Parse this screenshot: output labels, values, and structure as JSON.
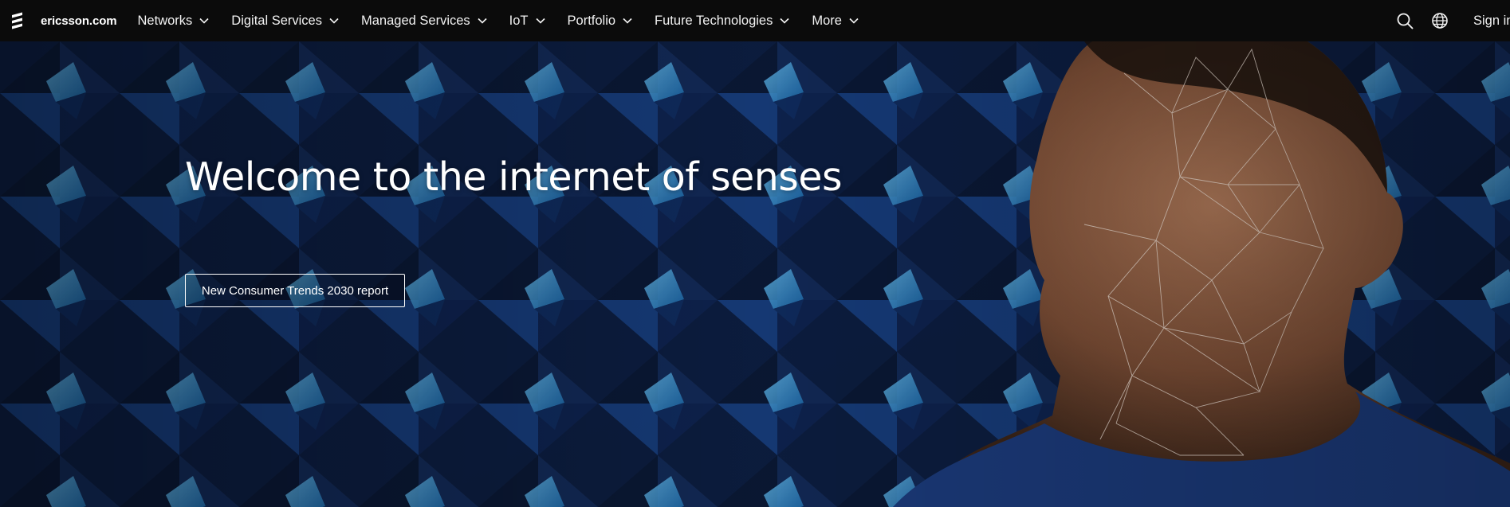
{
  "nav": {
    "brand": "ericsson.com",
    "items": [
      {
        "label": "Networks"
      },
      {
        "label": "Digital Services"
      },
      {
        "label": "Managed Services"
      },
      {
        "label": "IoT"
      },
      {
        "label": "Portfolio"
      },
      {
        "label": "Future Technologies"
      },
      {
        "label": "More"
      }
    ],
    "icons": {
      "logo": "ericsson-logo",
      "search": "search-icon",
      "language": "globe-icon",
      "dropdown": "chevron-down-icon"
    },
    "sign_in": "Sign in"
  },
  "hero": {
    "title": "Welcome to the internet of senses",
    "cta_label": "New Consumer Trends 2030 report"
  },
  "colors": {
    "nav_background": "#0b0b0b",
    "nav_text": "#f2f2f2",
    "hero_deep_blue": "#0b1a38",
    "hero_accent_blue": "#3aa0e0",
    "cta_border": "#ffffff"
  }
}
